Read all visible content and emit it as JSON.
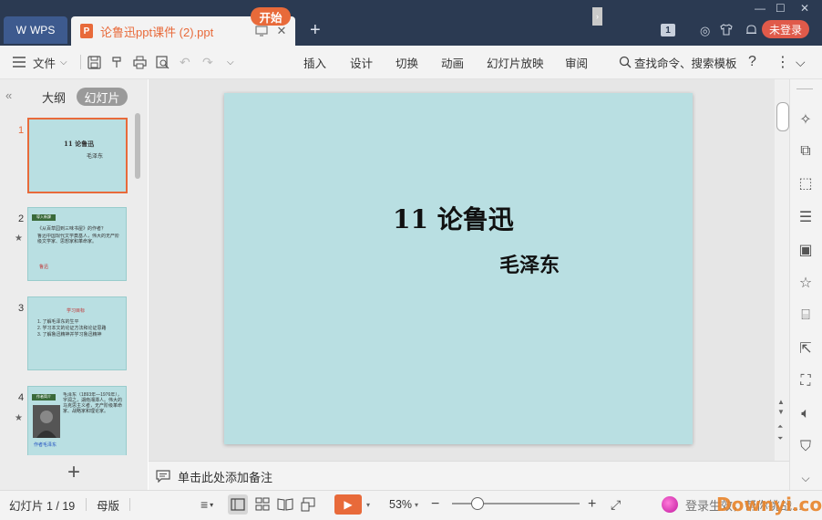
{
  "app": {
    "wps_tab_label": "WPS",
    "doc_tab_title": "论鲁迅ppt课件 (2).ppt",
    "new_tab_symbol": "+",
    "window_count": "1",
    "login_label": "未登录"
  },
  "ribbon": {
    "file_label": "文件",
    "tabs": [
      "开始",
      "插入",
      "设计",
      "切换",
      "动画",
      "幻灯片放映",
      "审阅"
    ],
    "search_label": "查找命令、搜索模板"
  },
  "left_panel": {
    "tab_outline": "大纲",
    "tab_slides": "幻灯片",
    "thumbnails": [
      {
        "num": "1",
        "title": "11  论鲁迅",
        "subtitle": "毛泽东"
      },
      {
        "num": "2",
        "header": "導入新課",
        "title_line": "《从百草园到三味书屋》的作者？",
        "body": "鲁迅中国现代文学奠基人，伟大的无产阶级文学家、思想家和革命家。",
        "footer": "鲁迅"
      },
      {
        "num": "3",
        "header": "学习目标",
        "items": [
          "1. 了解毛泽东的生平",
          "2. 学习本文的论证方法和论证思路",
          "3. 了解鲁迅精神并学习鲁迅精神"
        ]
      },
      {
        "num": "4",
        "header": "作者简介",
        "body": "毛泽东（1893年—1976年），字润之，湖南湘潭人。伟大的马克思主义者，无产阶级革命家、战略家和理论家。",
        "footer": "作者毛泽东"
      }
    ]
  },
  "slide": {
    "title": "11  论鲁迅",
    "author": "毛泽东"
  },
  "notes": {
    "placeholder": "单击此处添加备注"
  },
  "status": {
    "slide_counter": "幻灯片 1 / 19",
    "master_label": "母版",
    "zoom": "53%",
    "zoom_level": 0.2
  },
  "watermark": {
    "text": "登录生效，帮你挑战...",
    "site": "Downyi.com"
  },
  "colors": {
    "accent": "#e86a3a",
    "titlebar": "#2b3a52",
    "slide_bg": "#b9dfe2",
    "login": "#e05a4a"
  }
}
